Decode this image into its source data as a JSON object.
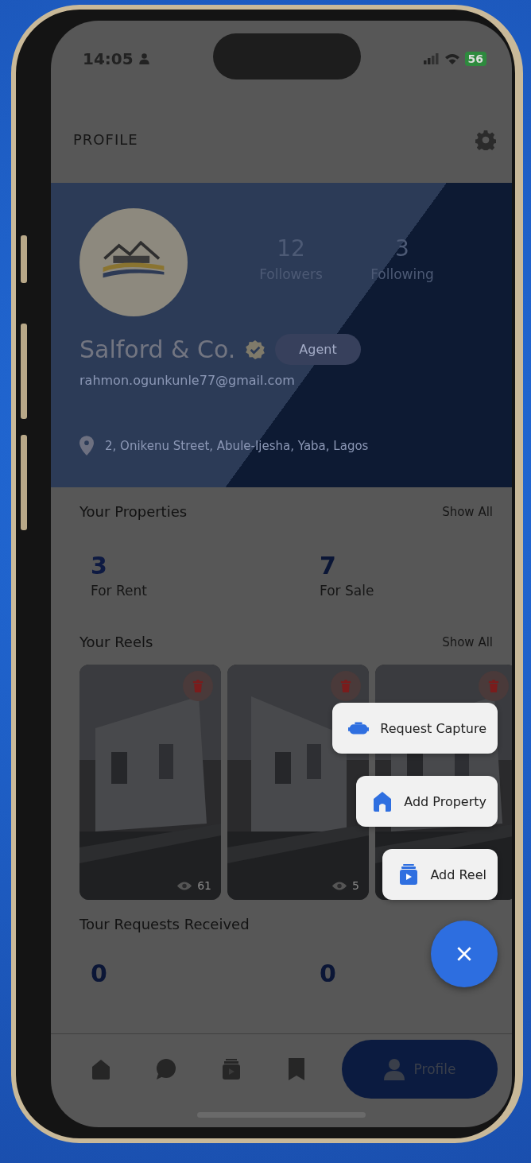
{
  "status_bar": {
    "time": "14:05",
    "battery": "56"
  },
  "header": {
    "title": "PROFILE"
  },
  "profile": {
    "name": "Salford & Co.",
    "verified": true,
    "role": "Agent",
    "email": "rahmon.ogunkunle77@gmail.com",
    "address": "2, Onikenu Street, Abule-Ijesha, Yaba, Lagos",
    "stats": [
      {
        "value": "12",
        "label": "Followers"
      },
      {
        "value": "3",
        "label": "Following"
      }
    ]
  },
  "properties": {
    "title": "Your Properties",
    "link": "Show All",
    "stats": [
      {
        "value": "3",
        "label": "For Rent"
      },
      {
        "value": "7",
        "label": "For Sale"
      }
    ]
  },
  "reels": {
    "title": "Your Reels",
    "link": "Show All",
    "items": [
      {
        "kind": "picture",
        "views": "61"
      },
      {
        "kind": "picture",
        "views": "5"
      },
      {
        "kind": "picture"
      }
    ]
  },
  "tour_requests": {
    "title": "Tour Requests Received",
    "stats": [
      {
        "value": "0"
      },
      {
        "value": "0"
      }
    ]
  },
  "fab_menu": {
    "open": true,
    "items": [
      {
        "kind": "capture",
        "label": "Request Capture"
      },
      {
        "kind": "property",
        "label": "Add Property"
      },
      {
        "kind": "reel",
        "label": "Add Reel"
      }
    ]
  },
  "nav": {
    "items": [
      {
        "kind": "home",
        "selected": false
      },
      {
        "kind": "chat",
        "selected": false
      },
      {
        "kind": "reels",
        "selected": false
      },
      {
        "kind": "saved",
        "selected": false
      },
      {
        "kind": "profile",
        "label": "Profile",
        "selected": true
      }
    ]
  }
}
